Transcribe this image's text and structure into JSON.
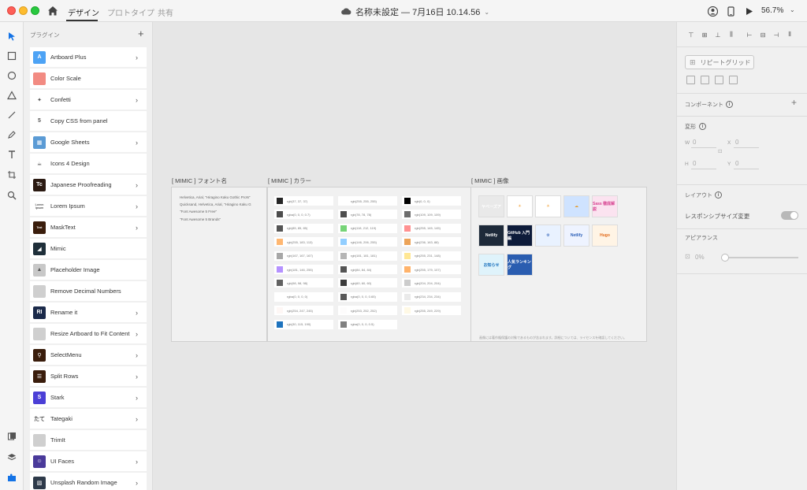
{
  "titlebar": {
    "tabs": [
      "デザイン",
      "プロトタイプ",
      "共有"
    ],
    "document_title": "名称未設定 — 7月16日 10.14.56",
    "zoom": "56.7%"
  },
  "plugins": {
    "header": "プラグイン",
    "items": [
      {
        "label": "Artboard Plus",
        "icon": "A",
        "icon_color": "#4da3f5",
        "has_submenu": true
      },
      {
        "label": "Color Scale",
        "icon": "",
        "icon_color": "#f28b82",
        "has_submenu": false
      },
      {
        "label": "Confetti",
        "icon": "✦",
        "icon_color": "#ffffff",
        "has_submenu": true
      },
      {
        "label": "Copy CSS from panel",
        "icon": "5",
        "icon_color": "#ffffff",
        "has_submenu": false
      },
      {
        "label": "Google Sheets",
        "icon": "▦",
        "icon_color": "#5b9bd5",
        "has_submenu": true
      },
      {
        "label": "Icons 4 Design",
        "icon": "☕",
        "icon_color": "#ffffff",
        "has_submenu": false
      },
      {
        "label": "Japanese Proofreading",
        "icon": "Tc",
        "icon_color": "#2b1a12",
        "has_submenu": true
      },
      {
        "label": "Lorem Ipsum",
        "icon": "Lorem Ipsum",
        "icon_color": "#ffffff",
        "has_submenu": true
      },
      {
        "label": "MaskText",
        "icon": "Text",
        "icon_color": "#3a1d0c",
        "has_submenu": true
      },
      {
        "label": "Mimic",
        "icon": "◢",
        "icon_color": "#1f2f3a",
        "has_submenu": false
      },
      {
        "label": "Placeholder Image",
        "icon": "▲",
        "icon_color": "#c8c8c8",
        "has_submenu": false
      },
      {
        "label": "Remove Decimal Numbers",
        "icon": "",
        "icon_color": "#cfcfcf",
        "has_submenu": false
      },
      {
        "label": "Rename it",
        "icon": "RI",
        "icon_color": "#1b2a4a",
        "has_submenu": true
      },
      {
        "label": "Resize Artboard to Fit Content",
        "icon": "",
        "icon_color": "#cfcfcf",
        "has_submenu": true
      },
      {
        "label": "SelectMenu",
        "icon": "⚲",
        "icon_color": "#3a1d0c",
        "has_submenu": true
      },
      {
        "label": "Split Rows",
        "icon": "☰",
        "icon_color": "#3a1d0c",
        "has_submenu": true
      },
      {
        "label": "Stark",
        "icon": "S",
        "icon_color": "#4b3fd6",
        "has_submenu": true
      },
      {
        "label": "Tategaki",
        "icon": "たて",
        "icon_color": "#ffffff",
        "has_submenu": true
      },
      {
        "label": "TrimIt",
        "icon": "",
        "icon_color": "#cfcfcf",
        "has_submenu": false
      },
      {
        "label": "UI Faces",
        "icon": "☺",
        "icon_color": "#4a3a9a",
        "has_submenu": true
      },
      {
        "label": "Unsplash Random Image",
        "icon": "▧",
        "icon_color": "#2e3a4a",
        "has_submenu": true
      }
    ]
  },
  "canvas": {
    "artboards": {
      "fonts": {
        "label": "[ MIMIC ] フォント名",
        "lines": [
          "Helvetica, Arial, \"Hiragino Kaku Gothic ProN\"",
          "Quicksand, Helvetica, Arial, \"Hiragino Kaku G",
          "\"Font Awesome 5 Free\"",
          "\"Font Awesome 5 Brands\""
        ]
      },
      "colors": {
        "label": "[ MIMIC ] カラー",
        "columns": [
          [
            {
              "label": "rgb(37, 37, 37)",
              "color": "#252525"
            },
            {
              "label": "rgba(0, 0, 0, 0.7)",
              "color": "#4d4d4d"
            },
            {
              "label": "rgb(85, 85, 85)",
              "color": "#555555"
            },
            {
              "label": "rgb(255, 183, 113)",
              "color": "#ffb771"
            },
            {
              "label": "rgb(167, 167, 167)",
              "color": "#a7a7a7"
            },
            {
              "label": "rgb(181, 146, 255)",
              "color": "#b592ff"
            },
            {
              "label": "rgb(98, 98, 98)",
              "color": "#626262"
            },
            {
              "label": "rgba(0, 0, 0, 0)",
              "color": "#ffffff"
            },
            {
              "label": "rgb(254, 247, 245)",
              "color": "#fef7f5"
            },
            {
              "label": "rgb(30, 115, 190)",
              "color": "#1e73be"
            }
          ],
          [
            {
              "label": "rgb(255, 255, 255)",
              "color": "#ffffff"
            },
            {
              "label": "rgb(78, 78, 78)",
              "color": "#4e4e4e"
            },
            {
              "label": "rgb(118, 212, 119)",
              "color": "#76d477"
            },
            {
              "label": "rgb(146, 206, 255)",
              "color": "#92ceff"
            },
            {
              "label": "rgb(181, 181, 181)",
              "color": "#b5b5b5"
            },
            {
              "label": "rgb(84, 84, 84)",
              "color": "#545454"
            },
            {
              "label": "rgb(60, 60, 60)",
              "color": "#3c3c3c"
            },
            {
              "label": "rgba(0, 0, 0, 0.65)",
              "color": "#595959"
            },
            {
              "label": "rgb(253, 252, 252)",
              "color": "#fdfcfc"
            },
            {
              "label": "rgba(0, 0, 0, 0.5)",
              "color": "#808080"
            }
          ],
          [
            {
              "label": "rgb(0, 0, 0)",
              "color": "#000000"
            },
            {
              "label": "rgb(109, 109, 109)",
              "color": "#6d6d6d"
            },
            {
              "label": "rgb(255, 145, 145)",
              "color": "#ff9191"
            },
            {
              "label": "rgb(236, 163, 88)",
              "color": "#eca358"
            },
            {
              "label": "rgb(255, 231, 148)",
              "color": "#ffe794"
            },
            {
              "label": "rgb(255, 179, 107)",
              "color": "#ffb36b"
            },
            {
              "label": "rgb(204, 204, 204)",
              "color": "#cccccc"
            },
            {
              "label": "rgb(234, 234, 234)",
              "color": "#eaeaea"
            },
            {
              "label": "rgb(255, 249, 229)",
              "color": "#fff9e5"
            }
          ]
        ]
      },
      "images": {
        "label": "[ MIMIC ] 画像",
        "thumbs": [
          {
            "text": "ヤベーズア",
            "bg": "#e9e9e9",
            "fg": "#ffffff"
          },
          {
            "text": "☀",
            "bg": "#ffffff",
            "fg": "#f2a23a"
          },
          {
            "text": "☀",
            "bg": "#ffffff",
            "fg": "#f2a23a"
          },
          {
            "text": "☁",
            "bg": "#cfe3ff",
            "fg": "#e39b2b"
          },
          {
            "text": "Sass 徹底解説",
            "bg": "#fbe3f0",
            "fg": "#d6418f"
          },
          {
            "text": "Netlify",
            "bg": "#1e2a3a",
            "fg": "#ffffff"
          },
          {
            "text": "GitHub 入門編",
            "bg": "#0d1b3a",
            "fg": "#ffffff"
          },
          {
            "text": "⚙",
            "bg": "#e9f2ff",
            "fg": "#2b5fb8"
          },
          {
            "text": "Netlify",
            "bg": "#eef3ff",
            "fg": "#2b5fb8"
          },
          {
            "text": "Hugo",
            "bg": "#fff4e5",
            "fg": "#e36b1a"
          },
          {
            "text": "お知らせ",
            "bg": "#dff3fb",
            "fg": "#1e73be"
          },
          {
            "text": "人気ランキング",
            "bg": "#2a5db0",
            "fg": "#ffffff"
          }
        ],
        "note": "画像には著作権保護の対象であるものが含まれます。詳細については、ライセンスを確認してください。"
      }
    }
  },
  "props": {
    "repeat_grid": "リピートグリッド",
    "component": "コンポーネント",
    "transform": "変形",
    "fields": {
      "w_label": "W",
      "w_value": "0",
      "x_label": "X",
      "x_value": "0",
      "h_label": "H",
      "h_value": "0",
      "y_label": "Y",
      "y_value": "0"
    },
    "layout": "レイアウト",
    "responsive": "レスポンシブサイズ変更",
    "appearance": "アピアランス",
    "opacity": "0%"
  }
}
